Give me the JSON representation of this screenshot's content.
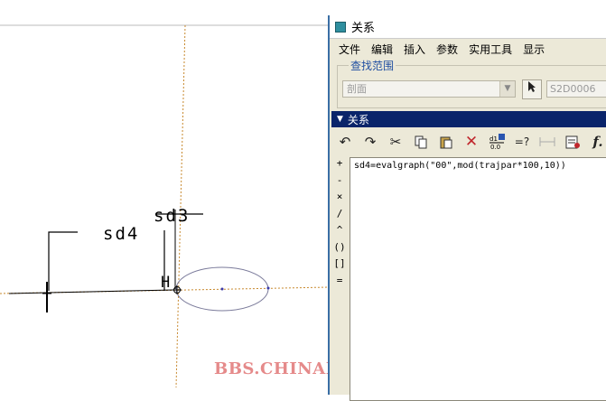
{
  "canvas": {
    "labels": {
      "sd4": "sd4",
      "sd3": "sd3",
      "h_mark": "H"
    },
    "watermark": "BBS.CHINADE.NET"
  },
  "window": {
    "title": "关系",
    "menu": [
      "文件",
      "编辑",
      "插入",
      "参数",
      "实用工具",
      "显示"
    ],
    "filter": {
      "legend": "查找范围",
      "scope_value": "剖面",
      "name_value": "S2D0006"
    },
    "relations_header": "关系",
    "toolbar_icons": [
      "undo-icon",
      "redo-icon",
      "cut-icon",
      "copy-icon",
      "paste-icon",
      "delete-icon",
      "evaluate-icon",
      "verify-icon",
      "dimension-icon",
      "parameters-icon",
      "function-icon"
    ],
    "toolbar_glyphs": {
      "verify": "=?"
    },
    "operators": [
      "+",
      "-",
      "×",
      "/",
      "^",
      "()",
      "[]",
      "="
    ],
    "relation_text": "sd4=evalgraph(\"00\",mod(trajpar*100,10))"
  },
  "colors": {
    "title_bar_bg": "#ffffff",
    "section_header_bg": "#0a246a",
    "window_bg": "#ece9d8",
    "watermark": "#e58a8a",
    "ellipse": "#7a7a9a"
  }
}
